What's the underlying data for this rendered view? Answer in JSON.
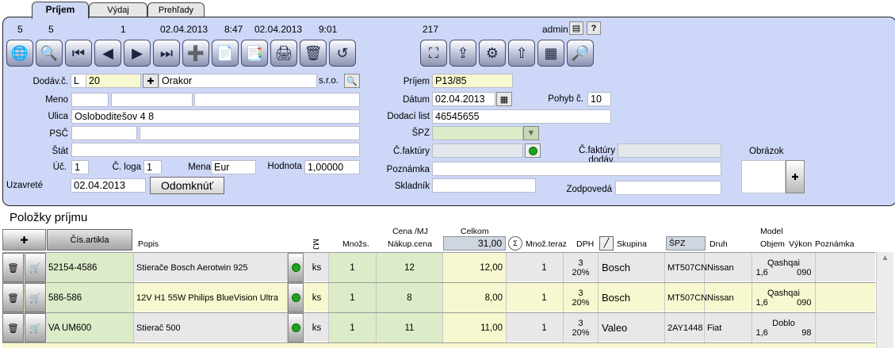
{
  "tabs": [
    "Príjem",
    "Výdaj",
    "Prehľady"
  ],
  "status": {
    "n1": "5",
    "n2": "5",
    "n3": "1",
    "date1": "02.04.2013",
    "time1": "8:47",
    "date2": "02.04.2013",
    "time2": "9:01",
    "count": "217",
    "user": "admin"
  },
  "supplier": {
    "dodav_label": "Dodáv.č.",
    "code_letter": "L",
    "code_number": "20",
    "name": "Orakor",
    "form": "s.r.o.",
    "meno_label": "Meno",
    "ulica_label": "Ulica",
    "ulica": "Osloboditešov 4 8",
    "psc_label": "PSČ",
    "stat_label": "Štát",
    "uct_label": "Úč.",
    "uct": "1",
    "cloga_label": "Č. loga",
    "cloga": "1",
    "mena_label": "Mena",
    "mena": "Eur",
    "hodnota_label": "Hodnota",
    "hodnota": "1,00000",
    "uzavrete_label": "Uzavreté",
    "uzavrete": "02.04.2013",
    "odom_label": "Odomknúť"
  },
  "receipt": {
    "prijem_label": "Príjem",
    "prijem": "P13/85",
    "datum_label": "Dátum",
    "datum": "02.04.2013",
    "pohyb_label": "Pohyb č.",
    "pohyb": "10",
    "dodaci_label": "Dodací list",
    "dodaci": "46545655",
    "spz_label": "ŠPZ",
    "cfakt_label": "Č.faktúry",
    "cfakt_dodav_label": "Č.faktúry dodáv.",
    "poznamka_label": "Poznámka",
    "skladnik_label": "Skladník",
    "zodpoveda_label": "Zodpovedá",
    "obrazok_label": "Obrázok"
  },
  "items": {
    "title": "Položky príjmu",
    "headers": {
      "cis": "Čís.artikla",
      "popis": "Popis",
      "mj": "MJ",
      "mnozs": "Množs.",
      "cena_top": "Cena /MJ",
      "cena_bottom": "Nákup.cena",
      "celkom": "Celkom",
      "celkom_value": "31,00",
      "mnoz_teraz": "Množ.teraz",
      "dph": "DPH",
      "skupina": "Skupina",
      "spz": "ŠPZ",
      "druh": "Druh",
      "model": "Model",
      "objem": "Objem",
      "vykon": "Výkon",
      "poznamka": "Poznámka"
    },
    "rows": [
      {
        "cis": "52154-4586",
        "popis": "Stierače Bosch Aerotwin 925",
        "mj": "ks",
        "mnozs": "1",
        "cena": "12",
        "celkom": "12,00",
        "teraz": "1",
        "dph_top": "3",
        "dph_bottom": "20%",
        "skupina": "Bosch",
        "spz": "MT507CN",
        "druh": "Nissan",
        "model": "Qashqai",
        "objem": "1,6",
        "vykon": "090"
      },
      {
        "cis": "586-586",
        "popis": "12V H1 55W Philips BlueVision Ultra",
        "mj": "ks",
        "mnozs": "1",
        "cena": "8",
        "celkom": "8,00",
        "teraz": "1",
        "dph_top": "3",
        "dph_bottom": "20%",
        "skupina": "Bosch",
        "spz": "MT507CN",
        "druh": "Nissan",
        "model": "Qashqai",
        "objem": "1,6",
        "vykon": "090"
      },
      {
        "cis": "VA UM600",
        "popis": "Stierač 500",
        "mj": "ks",
        "mnozs": "1",
        "cena": "11",
        "celkom": "11,00",
        "teraz": "1",
        "dph_top": "3",
        "dph_bottom": "20%",
        "skupina": "Valeo",
        "spz": "2AY1448",
        "druh": "Fiat",
        "model": "Doblo",
        "objem": "1,6",
        "vykon": "98"
      }
    ]
  }
}
